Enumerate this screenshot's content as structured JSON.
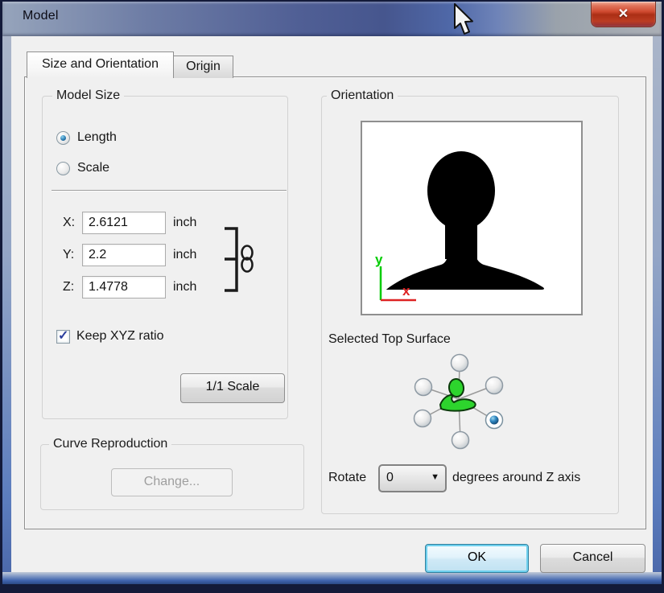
{
  "window": {
    "title": "Model"
  },
  "icons": {
    "close": "✕",
    "dropdown_arrow": "▼",
    "check": "✓"
  },
  "tabs": {
    "size_orientation": "Size and Orientation",
    "origin": "Origin"
  },
  "model_size": {
    "group_label": "Model Size",
    "length_label": "Length",
    "scale_label": "Scale",
    "fields": [
      {
        "axis": "X:",
        "value": "2.6121",
        "unit": "inch"
      },
      {
        "axis": "Y:",
        "value": "2.2",
        "unit": "inch"
      },
      {
        "axis": "Z:",
        "value": "1.4778",
        "unit": "inch"
      }
    ],
    "keep_ratio_label": "Keep XYZ ratio",
    "scale_button_label": "1/1 Scale"
  },
  "curve_reproduction": {
    "group_label": "Curve Reproduction",
    "change_button_label": "Change..."
  },
  "orientation": {
    "group_label": "Orientation",
    "axis_y_label": "y",
    "axis_x_label": "x",
    "selected_top_surface_label": "Selected Top Surface",
    "rotate_label": "Rotate",
    "rotate_value": "0",
    "rotate_suffix_label": "degrees around Z axis"
  },
  "footer": {
    "ok_label": "OK",
    "cancel_label": "Cancel"
  }
}
